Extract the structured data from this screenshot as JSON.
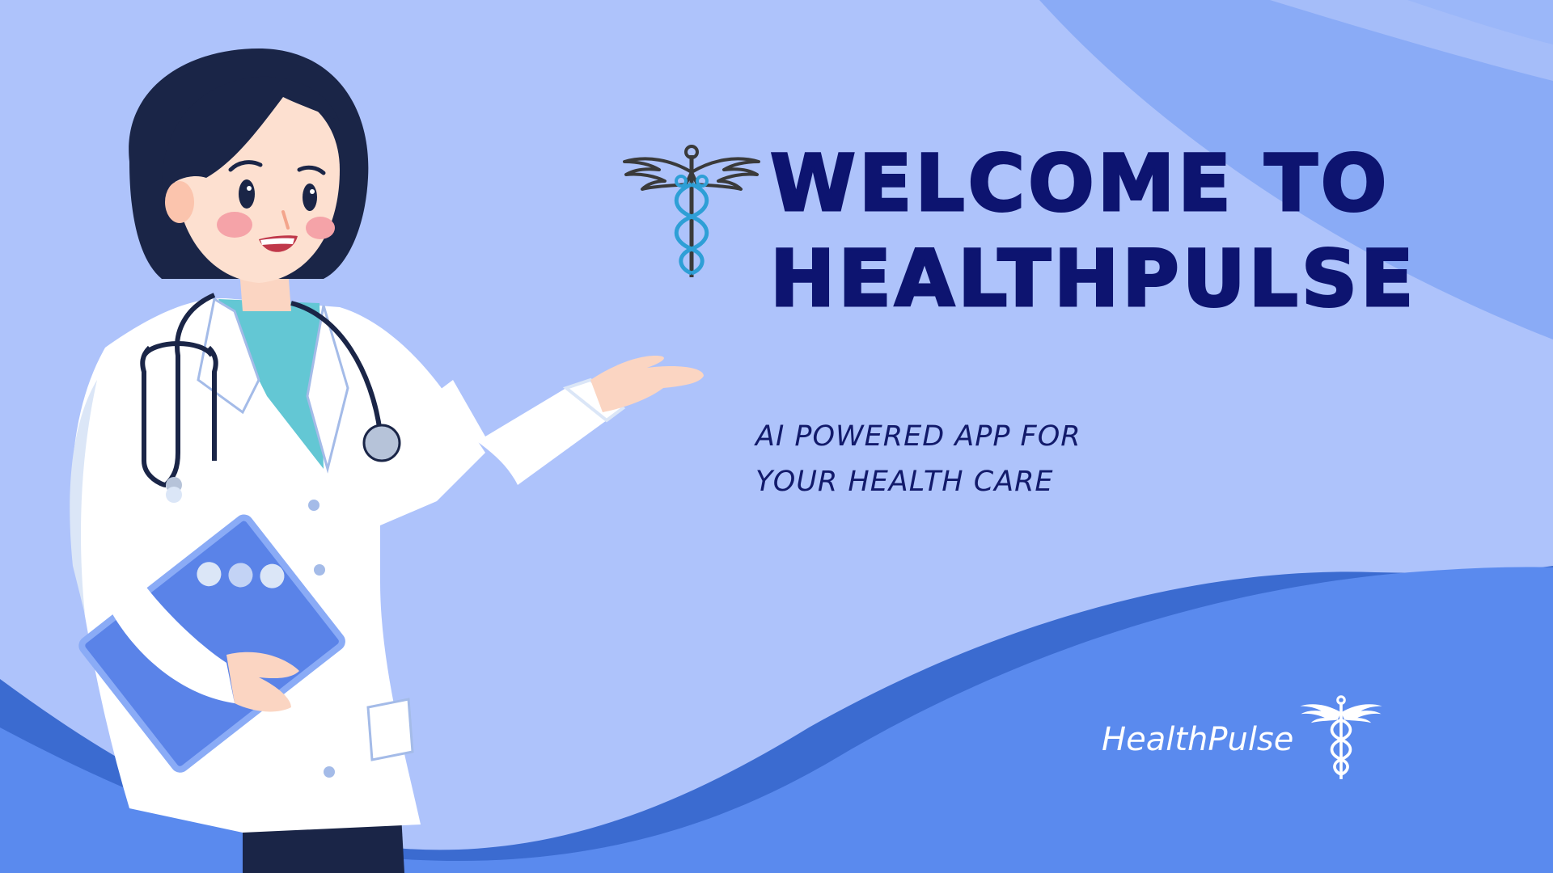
{
  "hero": {
    "title_line_1": "WELCOME TO",
    "title_line_2": "HEALTHPULSE",
    "subtitle_line_1": "AI POWERED APP FOR",
    "subtitle_line_2": "YOUR HEALTH CARE"
  },
  "brand": {
    "name": "HealthPulse",
    "icon": "caduceus-icon"
  },
  "illustration": {
    "subject": "doctor-illustration"
  },
  "colors": {
    "background": "#aec3fb",
    "title": "#0d1470",
    "wave_dark": "#3b6bd0",
    "wave_light": "#5a8aee"
  }
}
